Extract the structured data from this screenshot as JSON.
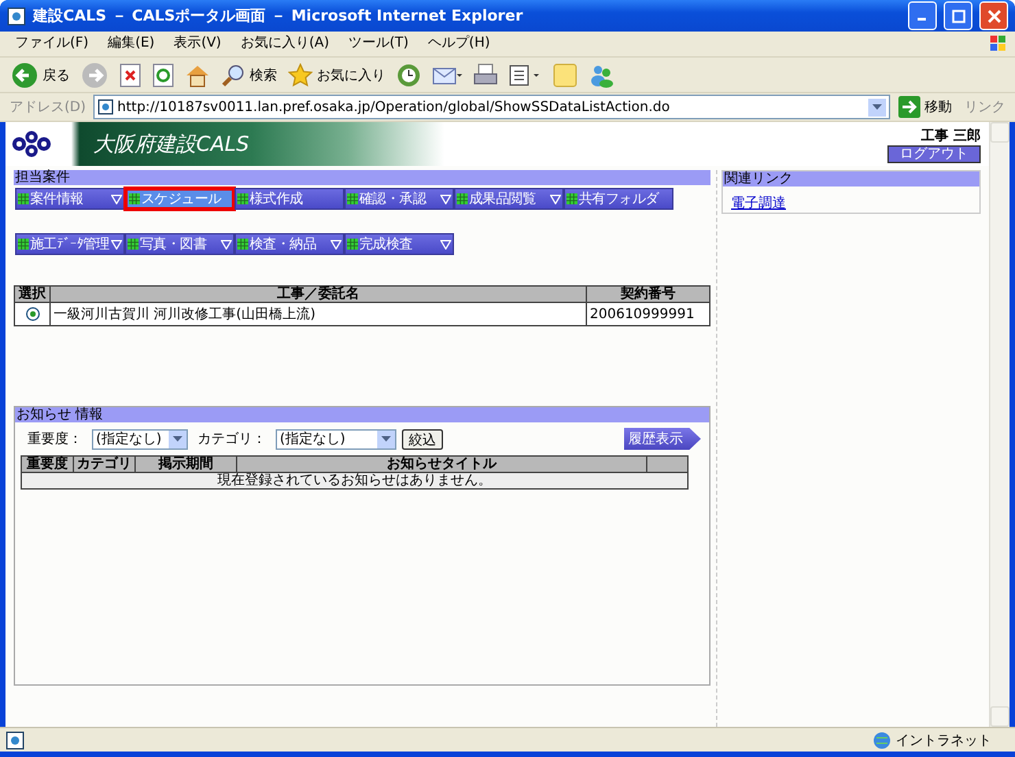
{
  "window": {
    "title": "建設CALS － CALSポータル画面 － Microsoft Internet Explorer"
  },
  "menu_bar": [
    "ファイル(F)",
    "編集(E)",
    "表示(V)",
    "お気に入り(A)",
    "ツール(T)",
    "ヘルプ(H)"
  ],
  "toolbar": [
    {
      "kind": "back",
      "label": "戻る"
    },
    {
      "kind": "forward"
    },
    {
      "kind": "stop"
    },
    {
      "kind": "refresh"
    },
    {
      "kind": "home"
    },
    {
      "kind": "search",
      "label": "検索"
    },
    {
      "kind": "favorites",
      "label": "お気に入り"
    },
    {
      "kind": "history"
    },
    {
      "kind": "mail"
    },
    {
      "kind": "print"
    },
    {
      "kind": "edit"
    },
    {
      "kind": "note"
    },
    {
      "kind": "messenger"
    }
  ],
  "address": {
    "label": "アドレス(D)",
    "value": "http://10187sv0011.lan.pref.osaka.jp/Operation/global/ShowSSDataListAction.do",
    "go": "移動",
    "links": "リンク"
  },
  "banner": {
    "title": "大阪府建設CALS",
    "user": "工事 三郎",
    "logout": "ログアウト"
  },
  "assigned": {
    "title": "担当案件",
    "menu_rows": [
      [
        {
          "label": "案件情報",
          "dropdown": true,
          "selected": false
        },
        {
          "label": "スケジュール",
          "dropdown": false,
          "selected": true
        },
        {
          "label": "様式作成",
          "dropdown": false,
          "selected": false
        },
        {
          "label": "確認・承認",
          "dropdown": true,
          "selected": false
        },
        {
          "label": "成果品閲覧",
          "dropdown": true,
          "selected": false
        },
        {
          "label": "共有フォルダ",
          "dropdown": false,
          "selected": false
        }
      ],
      [
        {
          "label": "施工ﾃﾞｰﾀ管理",
          "dropdown": true,
          "selected": false
        },
        {
          "label": "写真・図書",
          "dropdown": true,
          "selected": false
        },
        {
          "label": "検査・納品",
          "dropdown": true,
          "selected": false
        },
        {
          "label": "完成検査",
          "dropdown": true,
          "selected": false
        }
      ]
    ],
    "columns": [
      "選択",
      "工事／委託名",
      "契約番号"
    ],
    "rows": [
      {
        "selected": true,
        "name": "一級河川古賀川 河川改修工事(山田橋上流)",
        "number": "200610999991"
      }
    ]
  },
  "related": {
    "title": "関連リンク",
    "links": [
      "電子調達"
    ]
  },
  "notices": {
    "title": "お知らせ 情報",
    "filters": [
      {
        "label": "重要度：",
        "value": "(指定なし)"
      },
      {
        "label": "カテゴリ：",
        "value": "(指定なし)"
      }
    ],
    "filter_button": "絞込",
    "history_button": "履歴表示",
    "columns": [
      "重要度",
      "カテゴリ",
      "掲示期間",
      "お知らせタイトル"
    ],
    "empty": "現在登録されているお知らせはありません。"
  },
  "status_bar": {
    "zone": "イントラネット"
  }
}
